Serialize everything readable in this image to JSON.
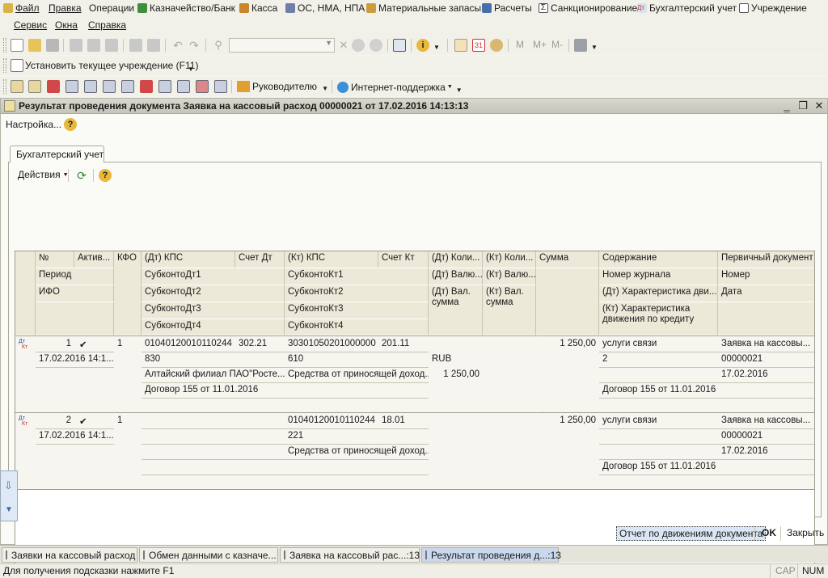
{
  "menu": {
    "items": [
      "Файл",
      "Правка",
      "Операции",
      "Казначейство/Банк",
      "Касса",
      "ОС, НМА, НПА",
      "Материальные запасы",
      "Расчеты",
      "Санкционирование",
      "Бухгалтерский учет",
      "Учреждение"
    ],
    "items2": [
      "Сервис",
      "Окна",
      "Справка"
    ]
  },
  "toolbar2": {
    "set_institution": "Установить текущее учреждение (F11)"
  },
  "toolbar3": {
    "manager": "Руководителю",
    "support": "Интернет-поддержка"
  },
  "toolbar1": {
    "m_buttons": [
      "M",
      "M+",
      "M-"
    ],
    "calendar_day": "31"
  },
  "window": {
    "title": "Результат проведения документа Заявка на кассовый расход 00000021 от 17.02.2016 14:13:13",
    "settings": "Настройка...",
    "help": "?"
  },
  "tab": {
    "label": "Бухгалтерский учет"
  },
  "actions": {
    "label": "Действия",
    "help": "?"
  },
  "grid": {
    "headers": {
      "num": "№",
      "active": "Актив...",
      "kfo": "КФО",
      "dt_kps": "(Дт) КПС",
      "account_dt": "Счет Дт",
      "kt_kps": "(Кт) КПС",
      "account_kt": "Счет Кт",
      "dt_qty": "(Дт) Коли...",
      "kt_qty": "(Кт) Коли...",
      "sum": "Сумма",
      "content": "Содержание",
      "primary_doc": "Первичный документ",
      "period": "Период",
      "subconto_dt1": "СубконтоДт1",
      "subconto_kt1": "СубконтоКт1",
      "dt_currency": "(Дт) Валю...",
      "kt_currency": "(Кт) Валю...",
      "journal_num": "Номер журнала",
      "number": "Номер",
      "ifo": "ИФО",
      "subconto_dt2": "СубконтоДт2",
      "subconto_kt2": "СубконтоКт2",
      "dt_cur_sum": "(Дт) Вал. сумма",
      "kt_cur_sum": "(Кт) Вал. сумма",
      "dt_movement": "(Дт) Характеристика дви...",
      "date": "Дата",
      "subconto_dt3": "СубконтоДт3",
      "subconto_kt3": "СубконтоКт3",
      "kt_movement": "(Кт) Характеристика движения по кредиту",
      "subconto_dt4": "СубконтоДт4",
      "subconto_kt4": "СубконтоКт4"
    },
    "rows": [
      {
        "num": "1",
        "active": "✔",
        "kfo": "1",
        "dt_kps": "01040120010110244",
        "account_dt": "302.21",
        "kt_kps": "30301050201000000",
        "account_kt": "201.11",
        "sum": "1 250,00",
        "content": "услуги связи",
        "primary_doc": "Заявка на кассовы...",
        "period": "17.02.2016 14:1...",
        "subconto_dt1": "830",
        "subconto_kt1": "610",
        "dt_currency": "RUB",
        "journal_num": "2",
        "number": "00000021",
        "subconto_dt2": "Алтайский филиал ПАО\"Росте...",
        "subconto_kt2": "Средства от приносящей доход...",
        "dt_cur_sum": "1 250,00",
        "date": "17.02.2016",
        "subconto_dt3": "Договор 155 от 11.01.2016",
        "kt_movement": "Договор 155 от 11.01.2016"
      },
      {
        "num": "2",
        "active": "✔",
        "kfo": "1",
        "dt_kps": "",
        "account_dt": "",
        "kt_kps": "01040120010110244",
        "account_kt": "18.01",
        "sum": "1 250,00",
        "content": "услуги связи",
        "primary_doc": "Заявка на кассовы...",
        "period": "17.02.2016 14:1...",
        "subconto_kt1": "221",
        "number": "00000021",
        "subconto_kt2": "Средства от приносящей доход...",
        "date": "17.02.2016",
        "kt_movement": "Договор 155 от 11.01.2016"
      }
    ]
  },
  "footer": {
    "report": "Отчет по движениям документа",
    "ok": "OK",
    "close": "Закрыть"
  },
  "taskbar": [
    "Заявки на кассовый расход",
    "Обмен данными с казначе...",
    "Заявка на кассовый рас...:13",
    "Результат проведения д...:13"
  ],
  "status": {
    "hint": "Для получения подсказки нажмите F1",
    "cap": "CAP",
    "num": "NUM"
  }
}
